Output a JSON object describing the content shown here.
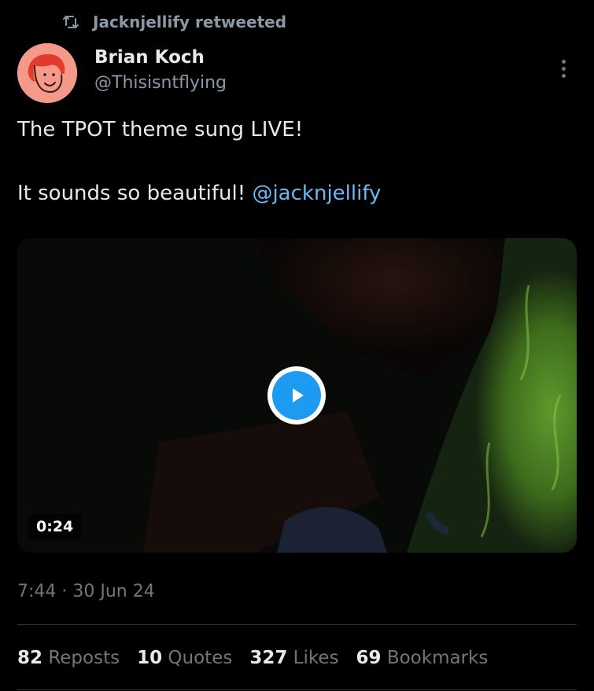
{
  "retweet": {
    "icon": "retweet-icon",
    "text": "Jacknjellify retweeted"
  },
  "author": {
    "display_name": "Brian Koch",
    "handle": "@Thisisntflying",
    "avatar_color": "#f59a8a"
  },
  "tweet": {
    "line1": "The TPOT theme sung LIVE!",
    "line2_text": "It sounds so beautiful! ",
    "mention": "@jacknjellify"
  },
  "media": {
    "type": "video",
    "duration": "0:24",
    "play_icon": "play-icon"
  },
  "meta": {
    "timestamp": "7:44 · 30 Jun 24"
  },
  "stats": [
    {
      "count": "82",
      "label": "Reposts"
    },
    {
      "count": "10",
      "label": "Quotes"
    },
    {
      "count": "327",
      "label": "Likes"
    },
    {
      "count": "69",
      "label": "Bookmarks"
    }
  ],
  "colors": {
    "background": "#000000",
    "text_primary": "#e7e9ea",
    "text_secondary": "#71767b",
    "link": "#6cb8f0",
    "play_accent": "#1d9bf0"
  }
}
